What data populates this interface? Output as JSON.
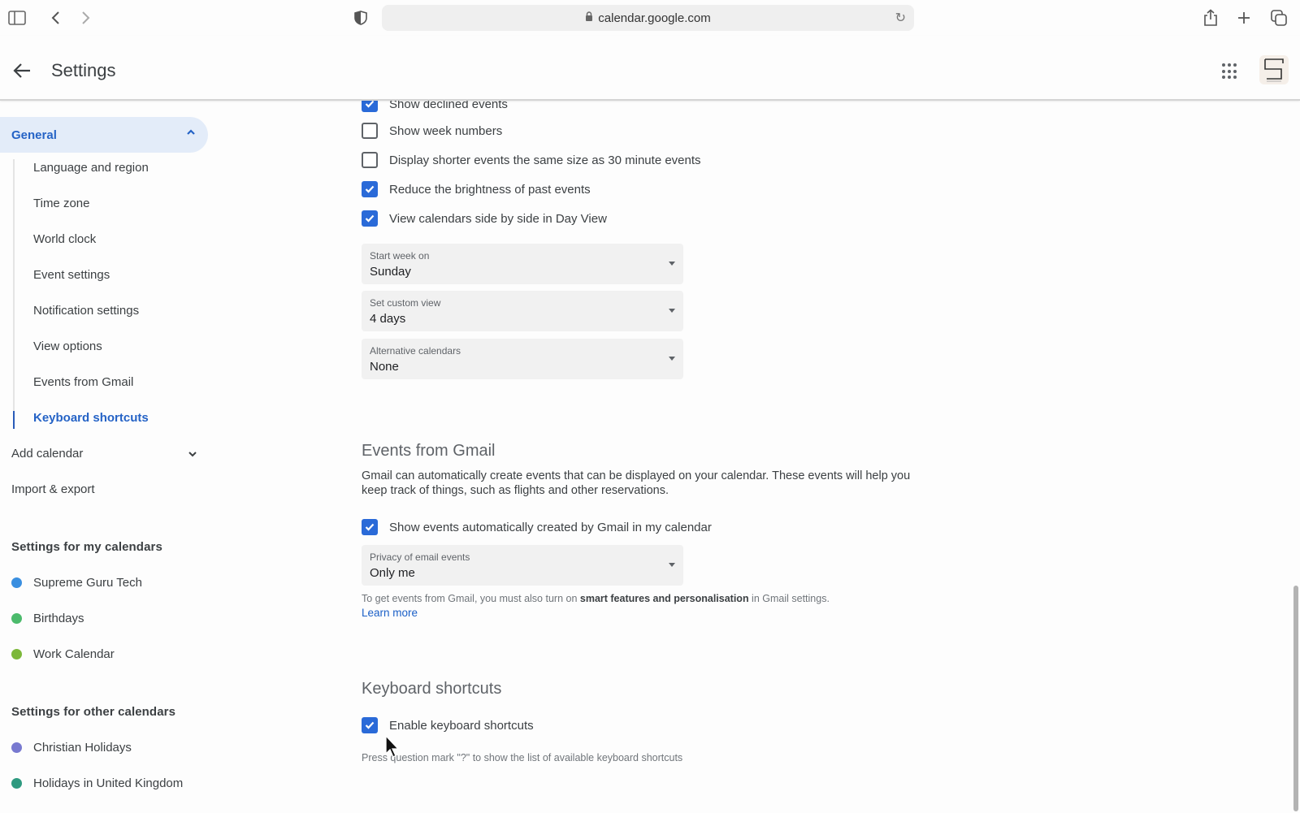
{
  "browser": {
    "url": "calendar.google.com",
    "icons": [
      "sidebar-toggle-icon",
      "back-icon",
      "forward-icon",
      "shield-icon",
      "lock-icon",
      "reload-icon",
      "share-icon",
      "new-tab-icon",
      "tabs-overview-icon"
    ]
  },
  "header": {
    "title": "Settings",
    "back_icon": "arrow-left-icon",
    "apps_icon": "apps-grid-icon",
    "avatar_letter": "S"
  },
  "sidebar": {
    "general": {
      "label": "General",
      "expanded": true
    },
    "general_items": [
      {
        "label": "Language and region"
      },
      {
        "label": "Time zone"
      },
      {
        "label": "World clock"
      },
      {
        "label": "Event settings"
      },
      {
        "label": "Notification settings"
      },
      {
        "label": "View options"
      },
      {
        "label": "Events from Gmail"
      },
      {
        "label": "Keyboard shortcuts",
        "active": true
      }
    ],
    "add_calendar": "Add calendar",
    "import_export": "Import & export",
    "my_calendars_heading": "Settings for my calendars",
    "my_calendars": [
      {
        "label": "Supreme Guru Tech",
        "color": "#3a8fe0"
      },
      {
        "label": "Birthdays",
        "color": "#4cbb6c"
      },
      {
        "label": "Work Calendar",
        "color": "#7cb83a"
      }
    ],
    "other_calendars_heading": "Settings for other calendars",
    "other_calendars": [
      {
        "label": "Christian Holidays",
        "color": "#7879d0"
      },
      {
        "label": "Holidays in United Kingdom",
        "color": "#2e9a80"
      }
    ]
  },
  "view_options": {
    "checkboxes": [
      {
        "label": "Show declined events",
        "checked": true
      },
      {
        "label": "Show week numbers",
        "checked": false
      },
      {
        "label": "Display shorter events the same size as 30 minute events",
        "checked": false
      },
      {
        "label": "Reduce the brightness of past events",
        "checked": true
      },
      {
        "label": "View calendars side by side in Day View",
        "checked": true
      }
    ],
    "selects": [
      {
        "label": "Start week on",
        "value": "Sunday"
      },
      {
        "label": "Set custom view",
        "value": "4 days"
      },
      {
        "label": "Alternative calendars",
        "value": "None"
      }
    ]
  },
  "events_from_gmail": {
    "title": "Events from Gmail",
    "description": "Gmail can automatically create events that can be displayed on your calendar. These events will help you keep track of things, such as flights and other reservations.",
    "checkbox": {
      "label": "Show events automatically created by Gmail in my calendar",
      "checked": true
    },
    "privacy_select": {
      "label": "Privacy of email events",
      "value": "Only me"
    },
    "note_prefix": "To get events from Gmail, you must also turn on ",
    "note_bold": "smart features and personalisation",
    "note_suffix": " in Gmail settings.",
    "learn_more": "Learn more"
  },
  "keyboard_shortcuts": {
    "title": "Keyboard shortcuts",
    "checkbox": {
      "label": "Enable keyboard shortcuts",
      "checked": true
    },
    "note": "Press question mark \"?\" to show the list of available keyboard shortcuts"
  },
  "colors": {
    "accent": "#2a6ad8",
    "nav_active_bg": "#e3ecf9",
    "nav_active_text": "#2563c6"
  }
}
